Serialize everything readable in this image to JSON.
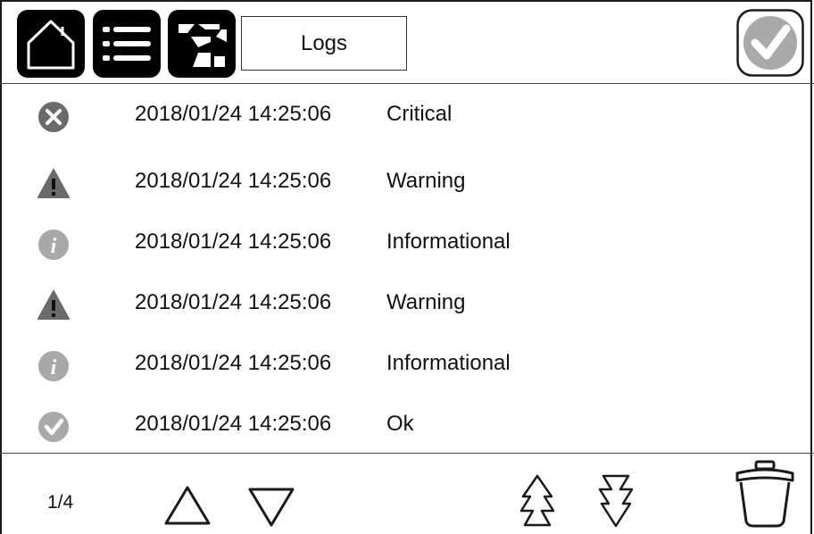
{
  "header": {
    "home_icon": "home-icon",
    "menu_icon": "list-icon",
    "logs_icon": "event-log-icon",
    "title": "Logs",
    "status_icon": "status-ok-check-icon",
    "accent_color": "#000000"
  },
  "logs": [
    {
      "icon": "critical-x-icon",
      "timestamp": "2018/01/24 14:25:06",
      "severity": "Critical"
    },
    {
      "icon": "warning-triangle-icon",
      "timestamp": "2018/01/24 14:25:06",
      "severity": "Warning"
    },
    {
      "icon": "info-icon",
      "timestamp": "2018/01/24 14:25:06",
      "severity": "Informational"
    },
    {
      "icon": "warning-triangle-icon",
      "timestamp": "2018/01/24 14:25:06",
      "severity": "Warning"
    },
    {
      "icon": "info-icon",
      "timestamp": "2018/01/24 14:25:06",
      "severity": "Informational"
    },
    {
      "icon": "ok-check-icon",
      "timestamp": "2018/01/24 14:25:06",
      "severity": "Ok"
    }
  ],
  "footer": {
    "page_indicator": "1/4",
    "buttons": [
      "scroll-up-icon",
      "scroll-down-icon",
      "page-up-icon",
      "page-down-icon",
      "delete-trash-icon"
    ]
  },
  "colors": {
    "icon_gray": "#6b6b6b",
    "ok_gray": "#a9a9a9",
    "line": "#333333"
  }
}
